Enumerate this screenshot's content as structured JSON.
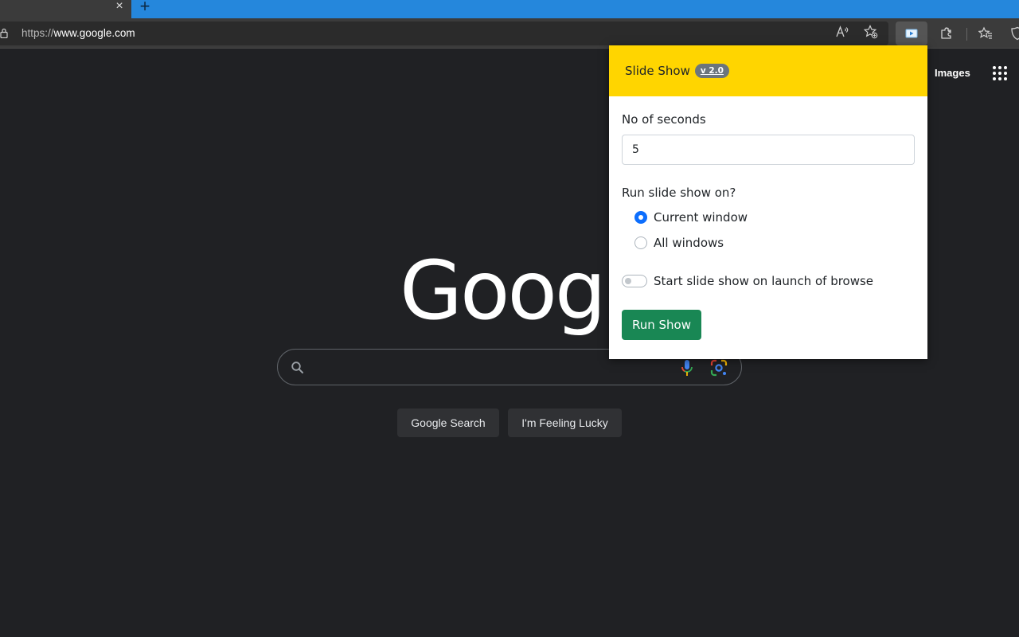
{
  "browser": {
    "tab_close": "×",
    "new_tab": "+",
    "url_scheme": "https://",
    "url_host": "www.google.com",
    "icons": [
      "lock-icon",
      "read-aloud-icon",
      "add-favorite-icon",
      "slideshow-extension-icon",
      "extensions-icon",
      "favorites-icon",
      "browser-essentials-icon"
    ]
  },
  "google": {
    "images_link": "Images",
    "logo_text": "Google",
    "search_button": "Google Search",
    "lucky_button": "I'm Feeling Lucky"
  },
  "popup": {
    "title": "Slide Show",
    "version": "v 2.0",
    "seconds_label": "No of seconds",
    "seconds_value": "5",
    "run_on_label": "Run slide show on?",
    "options": [
      {
        "label": "Current window",
        "checked": true
      },
      {
        "label": "All windows",
        "checked": false
      }
    ],
    "launch_toggle_label": "Start slide show on launch of browse",
    "launch_toggle_on": false,
    "run_button": "Run Show",
    "colors": {
      "header": "#ffd500",
      "badge": "#6c757d",
      "radio_checked": "#0d6efd",
      "run_button": "#198754"
    }
  }
}
